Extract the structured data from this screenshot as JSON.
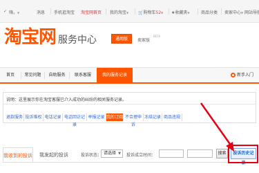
{
  "topbar": {
    "cart_link": "✓ 我要买",
    "hi": "嗨，",
    "msg": "消息",
    "login": "手机逛淘宝",
    "taobao_home": "淘宝网首页",
    "my_taobao": "我的淘宝",
    "cart": "购物车",
    "cart_count": "52",
    "favorites": "收藏夹",
    "categories": "商品分类",
    "seller_center": "卖家中心",
    "more": "网站导航"
  },
  "header": {
    "logo": "淘宝网",
    "service_center": "服务中心",
    "buyer_button": "通用版",
    "seller_label": "卖家版",
    "beta": "BETA"
  },
  "nav": {
    "items": [
      "首页",
      "常见问题",
      "自助服务",
      "联系客服",
      "我的服务记录"
    ],
    "newbie_label": "新手入门"
  },
  "panel": {
    "note": "说明：这里展示你在淘宝客服已介入成功的纠纷的相关服务记录。",
    "tabs": [
      "退款服务",
      "投诉维权",
      "电话记录",
      "电话回访记录",
      "举报记录",
      "我的订阅",
      "不合理申诉",
      "冻结记录",
      "商品违规"
    ]
  },
  "filters": {
    "tab_mine": "我收到的投诉",
    "tab_others": "我发起的投诉",
    "complaint_status_label": "投诉状态：",
    "select_value": "请选择",
    "complaint_time_label": "投诉成立时间：",
    "search_button": "搜索",
    "history_button": "投诉历史记录"
  }
}
